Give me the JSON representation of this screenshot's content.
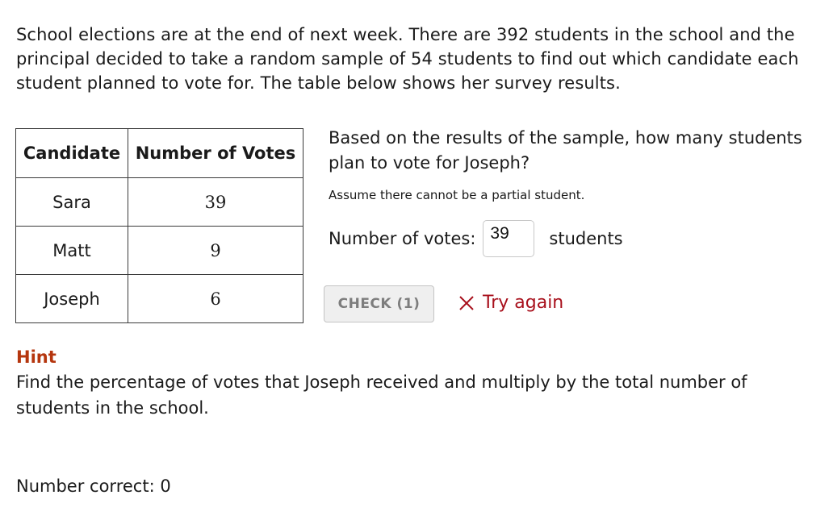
{
  "problem": {
    "intro": "School elections are at the end of next week. There are 392 students in the school and the principal decided to take a random sample of 54 students to find out which candidate each student planned to vote for. The table below shows her survey results."
  },
  "table": {
    "headers": [
      "Candidate",
      "Number of Votes"
    ],
    "rows": [
      {
        "candidate": "Sara",
        "votes": "39"
      },
      {
        "candidate": "Matt",
        "votes": "9"
      },
      {
        "candidate": "Joseph",
        "votes": "6"
      }
    ]
  },
  "question": {
    "text": "Based on the results of the sample, how many students plan to vote for Joseph?",
    "note": "Assume there cannot be a partial student."
  },
  "answer": {
    "label": "Number of votes:",
    "value": "39",
    "unit": "students"
  },
  "check_button": {
    "label": "CHECK (1)"
  },
  "feedback": {
    "icon": "x-icon",
    "text": "Try again",
    "color": "#a8101c"
  },
  "hint": {
    "title": "Hint",
    "text": "Find the percentage of votes that Joseph received and multiply by the total number of students in the school.",
    "color": "#b5360e"
  },
  "score": {
    "text": "Number correct: 0"
  }
}
